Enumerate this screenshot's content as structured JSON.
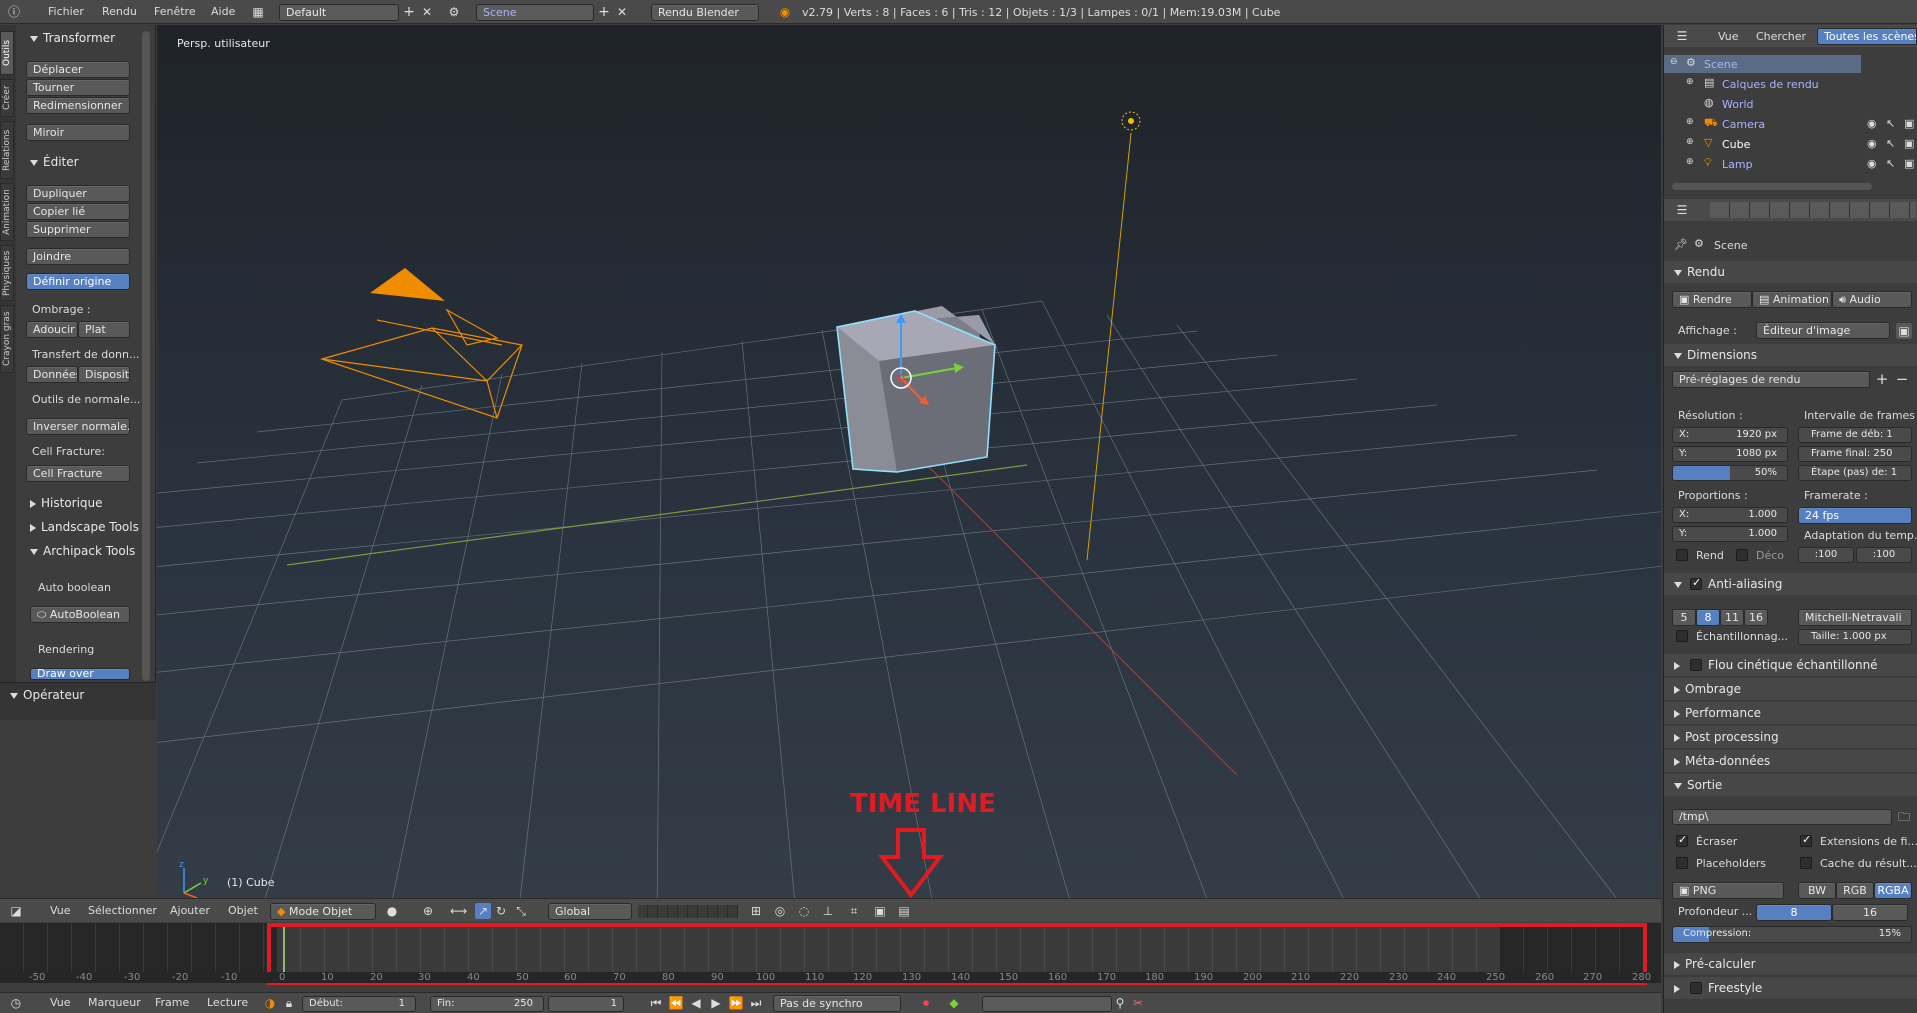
{
  "topbar": {
    "menus": [
      "Fichier",
      "Rendu",
      "Fenêtre",
      "Aide"
    ],
    "layout": "Default",
    "scene": "Scene",
    "engine": "Rendu Blender",
    "stats": "v2.79 | Verts : 8 | Faces : 6 | Tris : 12 | Objets : 1/3 | Lampes : 0/1 | Mem:19.03M | Cube"
  },
  "vtabs": [
    "Outils",
    "Créer",
    "Relations",
    "Animation",
    "Physiques",
    "Crayon gras"
  ],
  "toolshelf": {
    "transform_header": "Transformer",
    "transform_btns": [
      "Déplacer",
      "Tourner",
      "Redimensionner",
      "Miroir"
    ],
    "edit_header": "Éditer",
    "edit_btns": [
      "Dupliquer",
      "Copier lié",
      "Supprimer",
      "Joindre"
    ],
    "set_origin": "Définir origine",
    "shading_label": "Ombrage :",
    "smooth": "Adoucir",
    "flat": "Plat",
    "data_transfer": "Transfert de donn...",
    "data": "Données",
    "layout_btn": "Dispositi",
    "normals_tools": "Outils de normale...",
    "invert_normals": "Inverser normale...",
    "cell_fracture_label": "Cell Fracture:",
    "cell_fracture_btn": "Cell Fracture",
    "history": "Historique",
    "landscape": "Landscape Tools",
    "archipack": "Archipack Tools",
    "auto_boolean_label": "Auto boolean",
    "auto_boolean_btn": "AutoBoolean",
    "rendering": "Rendering",
    "draw_over": "Draw over",
    "operator": "Opérateur"
  },
  "viewport": {
    "view_label": "Persp. utilisateur",
    "object_label": "(1) Cube",
    "annotation": "TIME LINE"
  },
  "view3d_header": {
    "menus": [
      "Vue",
      "Sélectionner",
      "Ajouter",
      "Objet"
    ],
    "mode": "Mode Objet",
    "orientation": "Global"
  },
  "timeline": {
    "ruler": [
      "-50",
      "-40",
      "-30",
      "-20",
      "-10",
      "0",
      "10",
      "20",
      "30",
      "40",
      "50",
      "60",
      "70",
      "80",
      "90",
      "100",
      "110",
      "120",
      "130",
      "140",
      "150",
      "160",
      "170",
      "180",
      "190",
      "200",
      "210",
      "220",
      "230",
      "240",
      "250",
      "260",
      "270",
      "280"
    ],
    "menus": [
      "Vue",
      "Marqueur",
      "Frame",
      "Lecture"
    ],
    "start_label": "Début:",
    "start": "1",
    "end_label": "Fin:",
    "end": "250",
    "current": "1",
    "sync": "Pas de synchro"
  },
  "outliner": {
    "menus": [
      "Vue",
      "Chercher"
    ],
    "scope": "Toutes les scènes",
    "items": [
      "Scene",
      "Calques de rendu",
      "World",
      "Camera",
      "Cube",
      "Lamp"
    ]
  },
  "properties": {
    "breadcrumb": "Scene",
    "render_header": "Rendu",
    "render_btns": [
      "Rendre",
      "Animation",
      "Audio"
    ],
    "display_label": "Affichage :",
    "display_value": "Éditeur d'image",
    "dimensions_header": "Dimensions",
    "presets": "Pré-réglages de rendu",
    "resolution_label": "Résolution :",
    "res_x": "X:",
    "res_x_val": "1920 px",
    "res_y": "Y:",
    "res_y_val": "1080 px",
    "res_pct": "50%",
    "frame_range_label": "Intervalle de frames",
    "frame_start": "Frame de déb: 1",
    "frame_end": "Frame final: 250",
    "frame_step": "Étape (pas) de: 1",
    "aspect_label": "Proportions :",
    "asp_x": "X:",
    "asp_x_val": "1.000",
    "asp_y": "Y:",
    "asp_y_val": "1.000",
    "framerate_label": "Framerate :",
    "framerate": "24 fps",
    "time_remap_label": "Adaptation du temp...",
    "border": "Rend",
    "crop": "Déco",
    "remap_old": ":100",
    "remap_new": ":100",
    "aa_header": "Anti-aliasing",
    "aa_samples": [
      "5",
      "8",
      "11",
      "16"
    ],
    "aa_filter": "Mitchell-Netravali",
    "full_sample": "Échantillonnag...",
    "filter_size": "Taille: 1.000 px",
    "motion_blur": "Flou cinétique échantillonné",
    "shading": "Ombrage",
    "performance": "Performance",
    "post_processing": "Post processing",
    "metadata": "Méta-données",
    "output_header": "Sortie",
    "output_path": "/tmp\\",
    "overwrite": "Écraser",
    "file_ext": "Extensions de fi...",
    "placeholders": "Placeholders",
    "cache_result": "Cache du résult...",
    "format": "PNG",
    "color_modes": [
      "BW",
      "RGB",
      "RGBA"
    ],
    "depth_label": "Profondeur ...",
    "depth_8": "8",
    "depth_16": "16",
    "compression_label": "Compression:",
    "compression_val": "15%",
    "compression_fraction": 0.15,
    "bake": "Pré-calculer",
    "freestyle": "Freestyle"
  },
  "colors": {
    "accent": "#5680c2",
    "annotation_red": "#e11b22",
    "camera_orange": "#f08c00",
    "selected_outline": "#8fe1ff"
  }
}
